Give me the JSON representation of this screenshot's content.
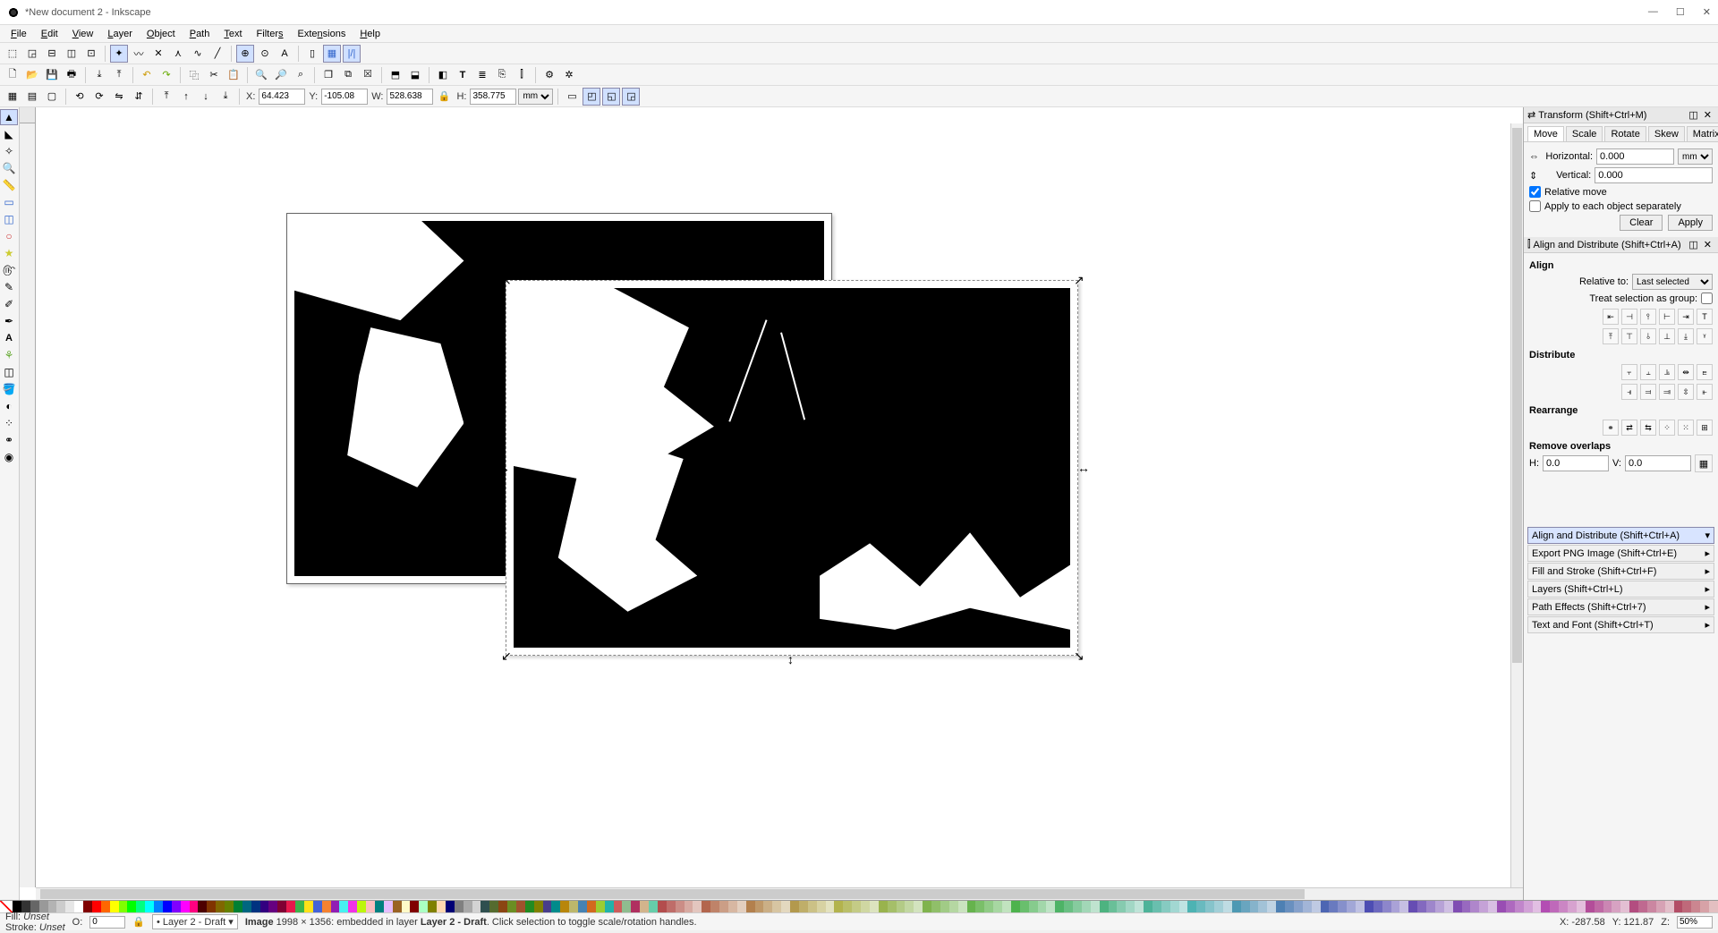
{
  "window": {
    "title": "*New document 2 - Inkscape"
  },
  "menu": [
    "File",
    "Edit",
    "View",
    "Layer",
    "Object",
    "Path",
    "Text",
    "Filters",
    "Extensions",
    "Help"
  ],
  "coords": {
    "x": "64.423",
    "y": "-105.08",
    "w": "528.638",
    "h": "358.775",
    "unit": "mm"
  },
  "transform": {
    "header": "Transform (Shift+Ctrl+M)",
    "tabs": [
      "Move",
      "Scale",
      "Rotate",
      "Skew",
      "Matrix"
    ],
    "horizontal_label": "Horizontal:",
    "horizontal": "0.000",
    "vertical_label": "Vertical:",
    "vertical": "0.000",
    "unit": "mm",
    "relative": "Relative move",
    "apply_each": "Apply to each object separately",
    "clear": "Clear",
    "apply": "Apply"
  },
  "align": {
    "header": "Align and Distribute (Shift+Ctrl+A)",
    "align_title": "Align",
    "relative_to_label": "Relative to:",
    "relative_to": "Last selected",
    "treat_group": "Treat selection as group:",
    "distribute_title": "Distribute",
    "rearrange_title": "Rearrange",
    "remove_overlaps_title": "Remove overlaps",
    "h_label": "H:",
    "h_val": "0.0",
    "v_label": "V:",
    "v_val": "0.0"
  },
  "docked": [
    {
      "label": "Align and Distribute (Shift+Ctrl+A)",
      "active": true
    },
    {
      "label": "Export PNG Image (Shift+Ctrl+E)",
      "active": false
    },
    {
      "label": "Fill and Stroke (Shift+Ctrl+F)",
      "active": false
    },
    {
      "label": "Layers (Shift+Ctrl+L)",
      "active": false
    },
    {
      "label": "Path Effects  (Shift+Ctrl+7)",
      "active": false
    },
    {
      "label": "Text and Font (Shift+Ctrl+T)",
      "active": false
    }
  ],
  "status": {
    "fill_label": "Fill:",
    "fill": "Unset",
    "stroke_label": "Stroke:",
    "stroke": "Unset",
    "o_label": "O:",
    "opacity": "0",
    "layer": "Layer 2 - Draft",
    "msg_prefix": "Image",
    "msg_dims": "1998 × 1356: embedded in layer",
    "msg_layer": "Layer 2 - Draft",
    "msg_suffix": ". Click selection to toggle scale/rotation handles.",
    "cursor_x": "X: -287.58",
    "cursor_y": "Y:  121.87",
    "zoom": "50%"
  },
  "palette_colors": [
    "#000",
    "#333",
    "#666",
    "#999",
    "#b3b3b3",
    "#ccc",
    "#e6e6e6",
    "#fff",
    "#800000",
    "#f00",
    "#f60",
    "#ff0",
    "#80ff00",
    "#0f0",
    "#00ff80",
    "#0ff",
    "#0080ff",
    "#00f",
    "#8000ff",
    "#f0f",
    "#ff0080",
    "#4d0000",
    "#803300",
    "#806600",
    "#668000",
    "#008033",
    "#006680",
    "#003380",
    "#330080",
    "#660080",
    "#800033",
    "#e6194b",
    "#3cb44b",
    "#ffe119",
    "#4363d8",
    "#f58231",
    "#911eb4",
    "#46f0f0",
    "#f032e6",
    "#bcf60c",
    "#fabebe",
    "#008080",
    "#e6beff",
    "#9a6324",
    "#fffac8",
    "#800000",
    "#aaffc3",
    "#808000",
    "#ffd8b1",
    "#000075",
    "#808080",
    "#a9a9a9",
    "#d3d3d3",
    "#2f4f4f",
    "#556b2f",
    "#8b4513",
    "#6b8e23",
    "#a0522d",
    "#228b22",
    "#808000",
    "#483d8b",
    "#008b8b",
    "#b8860b",
    "#bdb76b",
    "#4682b4",
    "#d2691e",
    "#9acd32",
    "#20b2aa",
    "#cd5c5c",
    "#8fbc8f",
    "#b03060",
    "#d2b48c",
    "#66cdaa"
  ]
}
